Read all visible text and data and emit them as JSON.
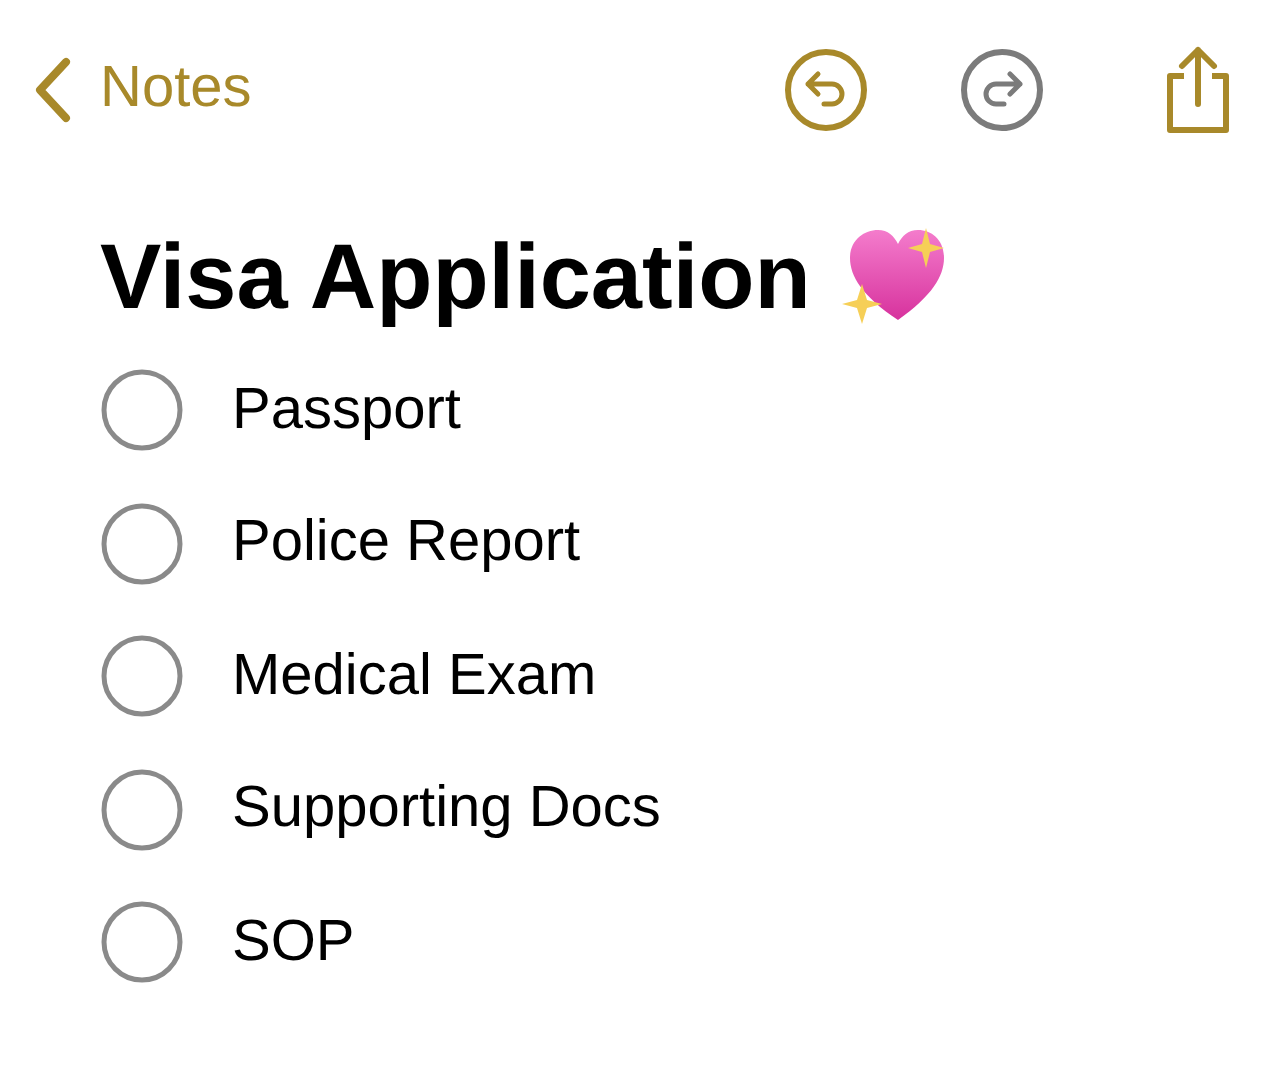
{
  "navigation": {
    "back_label": "Notes"
  },
  "toolbar": [
    {
      "kind": "undo",
      "disabled": false
    },
    {
      "kind": "redo",
      "disabled": true
    },
    {
      "kind": "share",
      "disabled": false
    }
  ],
  "note": {
    "title": "Visa Application",
    "checklist": [
      {
        "label": "Passport",
        "checked": false
      },
      {
        "label": "Police Report",
        "checked": false
      },
      {
        "label": "Medical Exam",
        "checked": false
      },
      {
        "label": "Supporting Docs",
        "checked": false
      },
      {
        "label": "SOP",
        "checked": false
      }
    ]
  }
}
